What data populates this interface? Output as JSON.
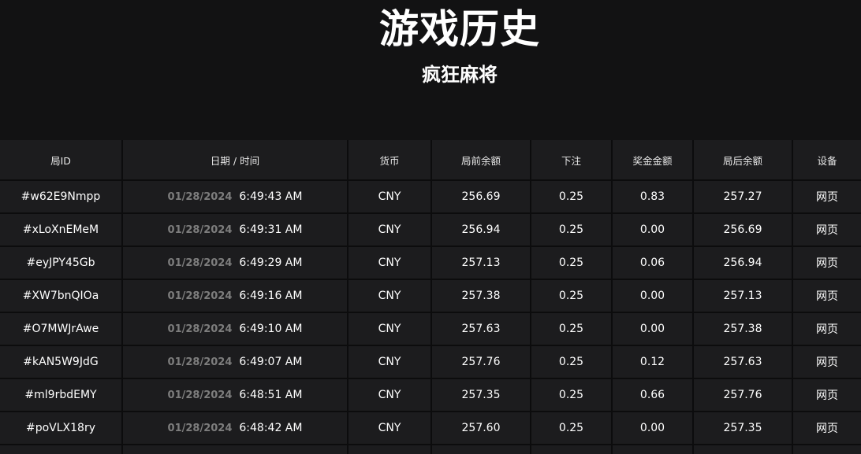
{
  "page": {
    "title": "游戏历史",
    "subtitle": "疯狂麻将"
  },
  "table": {
    "headers": {
      "id": "局ID",
      "datetime": "日期 / 时间",
      "currency": "货币",
      "balance_before": "局前余额",
      "bet": "下注",
      "win": "奖金金额",
      "balance_after": "局后余额",
      "device": "设备"
    },
    "rows": [
      {
        "id": "#w62E9Nmpp",
        "date": "01/28/2024",
        "time": "6:49:43 AM",
        "currency": "CNY",
        "balance_before": "256.69",
        "bet": "0.25",
        "win": "0.83",
        "balance_after": "257.27",
        "device": "网页"
      },
      {
        "id": "#xLoXnEMeM",
        "date": "01/28/2024",
        "time": "6:49:31 AM",
        "currency": "CNY",
        "balance_before": "256.94",
        "bet": "0.25",
        "win": "0.00",
        "balance_after": "256.69",
        "device": "网页"
      },
      {
        "id": "#eyJPY45Gb",
        "date": "01/28/2024",
        "time": "6:49:29 AM",
        "currency": "CNY",
        "balance_before": "257.13",
        "bet": "0.25",
        "win": "0.06",
        "balance_after": "256.94",
        "device": "网页"
      },
      {
        "id": "#XW7bnQIOa",
        "date": "01/28/2024",
        "time": "6:49:16 AM",
        "currency": "CNY",
        "balance_before": "257.38",
        "bet": "0.25",
        "win": "0.00",
        "balance_after": "257.13",
        "device": "网页"
      },
      {
        "id": "#O7MWJrAwe",
        "date": "01/28/2024",
        "time": "6:49:10 AM",
        "currency": "CNY",
        "balance_before": "257.63",
        "bet": "0.25",
        "win": "0.00",
        "balance_after": "257.38",
        "device": "网页"
      },
      {
        "id": "#kAN5W9JdG",
        "date": "01/28/2024",
        "time": "6:49:07 AM",
        "currency": "CNY",
        "balance_before": "257.76",
        "bet": "0.25",
        "win": "0.12",
        "balance_after": "257.63",
        "device": "网页"
      },
      {
        "id": "#ml9rbdEMY",
        "date": "01/28/2024",
        "time": "6:48:51 AM",
        "currency": "CNY",
        "balance_before": "257.35",
        "bet": "0.25",
        "win": "0.66",
        "balance_after": "257.76",
        "device": "网页"
      },
      {
        "id": "#poVLX18ry",
        "date": "01/28/2024",
        "time": "6:48:42 AM",
        "currency": "CNY",
        "balance_before": "257.60",
        "bet": "0.25",
        "win": "0.00",
        "balance_after": "257.35",
        "device": "网页"
      }
    ]
  }
}
